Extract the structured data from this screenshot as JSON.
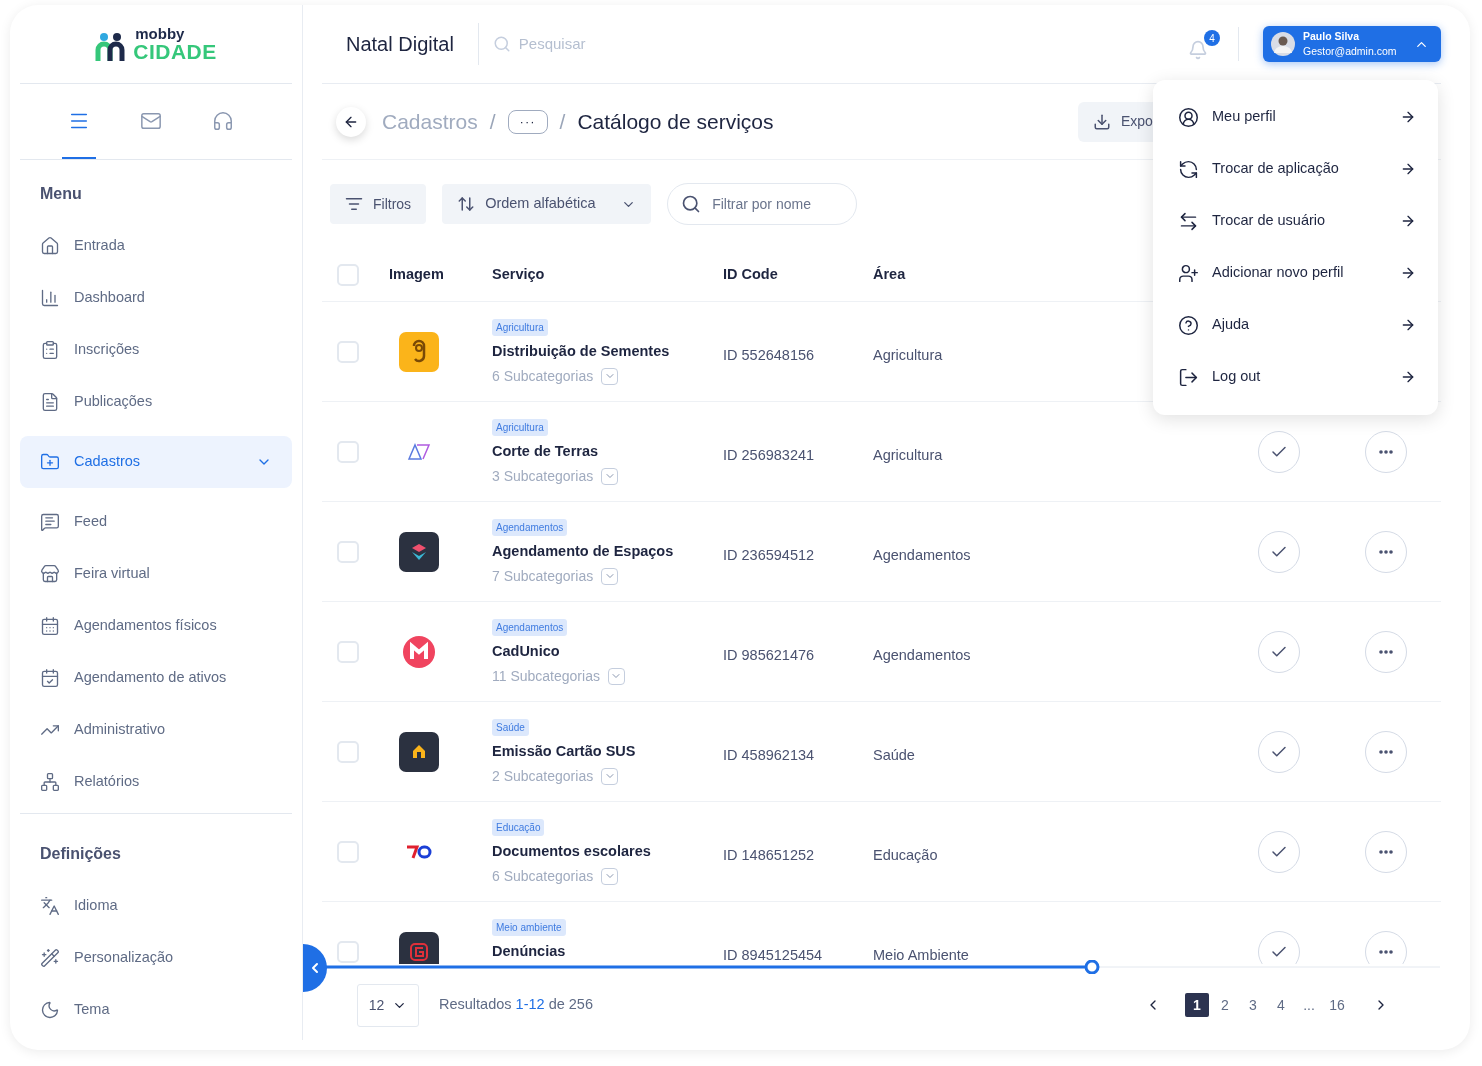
{
  "logo": {
    "top": "mobby",
    "bottom": "CIDADE"
  },
  "sidebar": {
    "tabs": [
      {
        "selected": true
      },
      {
        "selected": false
      },
      {
        "selected": false
      }
    ],
    "menu_heading": "Menu",
    "items": [
      {
        "label": "Entrada",
        "selected": false
      },
      {
        "label": "Dashboard",
        "selected": false
      },
      {
        "label": "Inscrições",
        "selected": false
      },
      {
        "label": "Publicações",
        "selected": false
      },
      {
        "label": "Cadastros",
        "selected": true,
        "expanded": false
      },
      {
        "label": "Feed",
        "selected": false
      },
      {
        "label": "Feira virtual",
        "selected": false
      },
      {
        "label": "Agendamentos físicos",
        "selected": false
      },
      {
        "label": "Agendamento de ativos",
        "selected": false
      },
      {
        "label": "Administrativo",
        "selected": false
      },
      {
        "label": "Relatórios",
        "selected": false
      }
    ],
    "settings_heading": "Definições",
    "settings": [
      {
        "label": "Idioma"
      },
      {
        "label": "Personalização"
      },
      {
        "label": "Tema"
      }
    ]
  },
  "header": {
    "title": "Natal Digital",
    "search_placeholder": "Pesquisar",
    "notifications": "4",
    "user": {
      "name": "Paulo Silva",
      "email": "Gestor@admin.com",
      "expanded": true
    }
  },
  "breadcrumb": {
    "root": "Cadastros",
    "separators": [
      "/",
      "/"
    ],
    "ellipsis": "···",
    "current": "Catálogo de serviços"
  },
  "export_button": "Expo",
  "filters": {
    "filter_button": "Filtros",
    "sort_button": "Ordem alfabética",
    "search_placeholder": "Filtrar por nome"
  },
  "table": {
    "select_all_checked": false,
    "columns": [
      "Imagem",
      "Serviço",
      "ID Code",
      "Área"
    ],
    "rows": [
      {
        "tag": "Agricultura",
        "name": "Distribuição de Sementes",
        "subcategories": "6 Subcategorias",
        "id": "ID 552648156",
        "area": "Agricultura",
        "checked": false,
        "actions_visible": false
      },
      {
        "tag": "Agricultura",
        "name": "Corte de Terras",
        "subcategories": "3 Subcategorias",
        "id": "ID 256983241",
        "area": "Agricultura",
        "checked": false,
        "actions_visible": true
      },
      {
        "tag": "Agendamentos",
        "name": "Agendamento de Espaços",
        "subcategories": "7 Subcategorias",
        "id": "ID 236594512",
        "area": "Agendamentos",
        "checked": false,
        "actions_visible": true
      },
      {
        "tag": "Agendamentos",
        "name": "CadUnico",
        "subcategories": "11 Subcategorias",
        "id": "ID 985621476",
        "area": "Agendamentos",
        "checked": false,
        "actions_visible": true
      },
      {
        "tag": "Saúde",
        "name": "Emissão Cartão SUS",
        "subcategories": "2 Subcategorias",
        "id": "ID 458962134",
        "area": "Saúde",
        "checked": false,
        "actions_visible": true
      },
      {
        "tag": "Educação",
        "name": "Documentos escolares",
        "subcategories": "6 Subcategorias",
        "id": "ID 148651252",
        "area": "Educação",
        "checked": false,
        "actions_visible": true
      },
      {
        "tag": "Meio ambiente",
        "name": "Denúncias",
        "id": "ID 8945125454",
        "area": "Meio Ambiente",
        "checked": false,
        "actions_visible": true
      }
    ]
  },
  "footer": {
    "per_page": "12",
    "results": {
      "prefix": "Resultados",
      "range": "1-12",
      "suffix": "de 256"
    },
    "pages": [
      {
        "label": "1",
        "selected": true
      },
      {
        "label": "2",
        "selected": false
      },
      {
        "label": "3",
        "selected": false
      },
      {
        "label": "4",
        "selected": false
      },
      {
        "label": "...",
        "selected": false
      },
      {
        "label": "16",
        "selected": false
      }
    ]
  },
  "user_menu": {
    "items": [
      {
        "label": "Meu perfil"
      },
      {
        "label": "Trocar de aplicação"
      },
      {
        "label": "Trocar de usuário"
      },
      {
        "label": "Adicionar novo perfil"
      },
      {
        "label": "Ajuda"
      },
      {
        "label": "Log out"
      }
    ]
  }
}
